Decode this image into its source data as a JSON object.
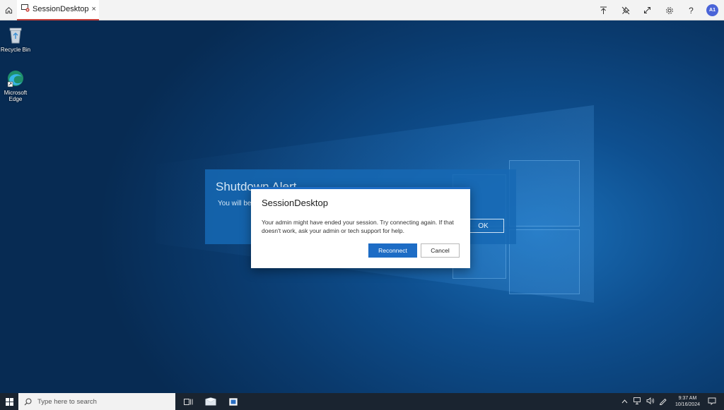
{
  "topbar": {
    "tab_label": "SessionDesktop",
    "tab_close": "×",
    "help_label": "?",
    "avatar_initials": "A1"
  },
  "desktop": {
    "icons": [
      {
        "label": "Recycle Bin",
        "icon": "recycle-bin-icon"
      },
      {
        "label": "Microsoft Edge",
        "icon": "edge-icon"
      }
    ],
    "accent": "#0b3a66"
  },
  "shutdown_alert": {
    "title": "Shutdown Alert",
    "text": "You will be",
    "ok_label": "OK"
  },
  "dialog": {
    "title": "SessionDesktop",
    "message": "Your admin might have ended your session. Try connecting again. If that doesn't work, ask your admin or tech support for help.",
    "reconnect_label": "Reconnect",
    "cancel_label": "Cancel",
    "accent": "#1d6cc5"
  },
  "taskbar": {
    "search_placeholder": "Type here to search",
    "time": "9:37 AM",
    "date": "10/16/2024"
  }
}
